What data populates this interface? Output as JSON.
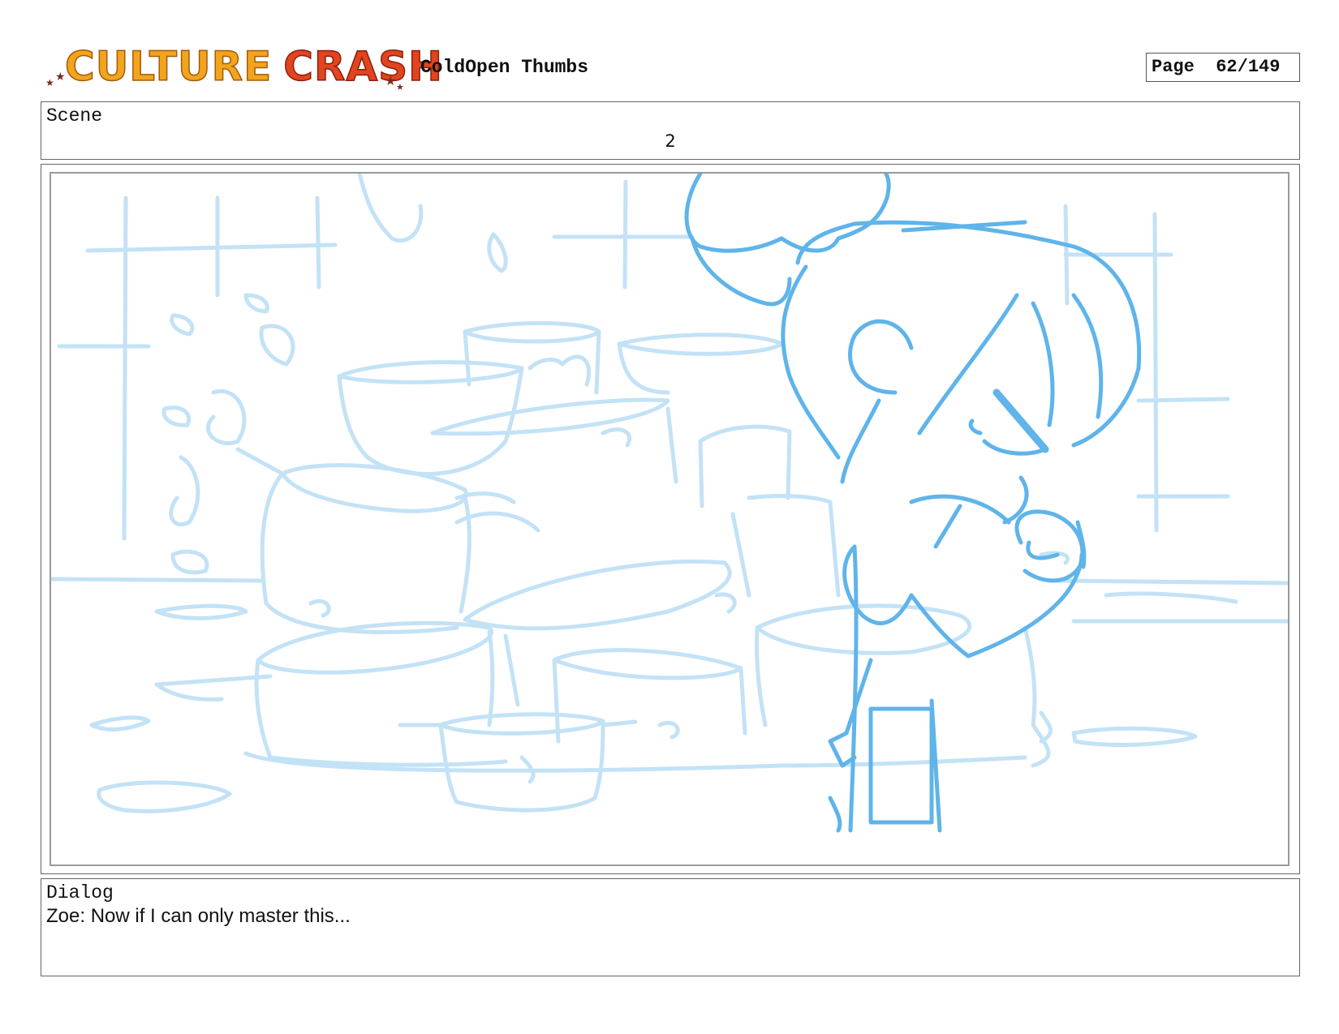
{
  "header": {
    "logo": {
      "word1": "CULTURE",
      "word2": "CRASH"
    },
    "title": "ColdOpen Thumbs",
    "page_label": "Page",
    "page_number": "62/149"
  },
  "scene": {
    "label": "Scene",
    "number": "2"
  },
  "panel": {
    "description_icons": [
      "kitchen-background-sketch",
      "stacked-pots-sketch",
      "zoe-character-sketch"
    ],
    "colors": {
      "background_lines": "#bfe0f5",
      "character_lines": "#5fb4ea",
      "frame": "#9a9a9a"
    }
  },
  "dialog": {
    "label": "Dialog",
    "text": "Zoe: Now if I can only master this..."
  }
}
